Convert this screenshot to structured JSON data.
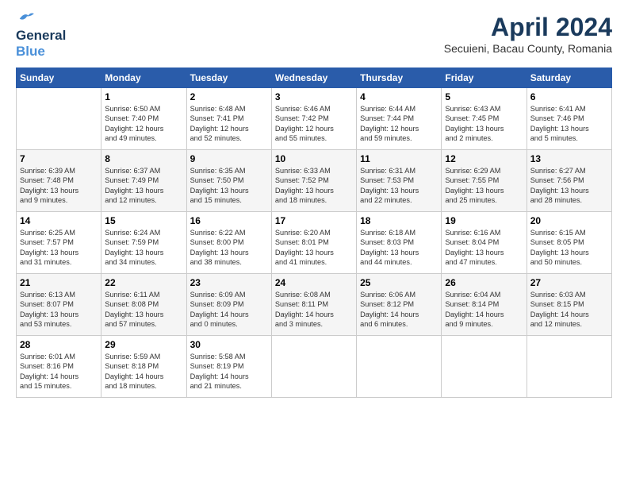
{
  "logo": {
    "line1": "General",
    "line2": "Blue"
  },
  "title": "April 2024",
  "subtitle": "Secuieni, Bacau County, Romania",
  "header_days": [
    "Sunday",
    "Monday",
    "Tuesday",
    "Wednesday",
    "Thursday",
    "Friday",
    "Saturday"
  ],
  "weeks": [
    [
      {
        "num": "",
        "info": ""
      },
      {
        "num": "1",
        "info": "Sunrise: 6:50 AM\nSunset: 7:40 PM\nDaylight: 12 hours\nand 49 minutes."
      },
      {
        "num": "2",
        "info": "Sunrise: 6:48 AM\nSunset: 7:41 PM\nDaylight: 12 hours\nand 52 minutes."
      },
      {
        "num": "3",
        "info": "Sunrise: 6:46 AM\nSunset: 7:42 PM\nDaylight: 12 hours\nand 55 minutes."
      },
      {
        "num": "4",
        "info": "Sunrise: 6:44 AM\nSunset: 7:44 PM\nDaylight: 12 hours\nand 59 minutes."
      },
      {
        "num": "5",
        "info": "Sunrise: 6:43 AM\nSunset: 7:45 PM\nDaylight: 13 hours\nand 2 minutes."
      },
      {
        "num": "6",
        "info": "Sunrise: 6:41 AM\nSunset: 7:46 PM\nDaylight: 13 hours\nand 5 minutes."
      }
    ],
    [
      {
        "num": "7",
        "info": "Sunrise: 6:39 AM\nSunset: 7:48 PM\nDaylight: 13 hours\nand 9 minutes."
      },
      {
        "num": "8",
        "info": "Sunrise: 6:37 AM\nSunset: 7:49 PM\nDaylight: 13 hours\nand 12 minutes."
      },
      {
        "num": "9",
        "info": "Sunrise: 6:35 AM\nSunset: 7:50 PM\nDaylight: 13 hours\nand 15 minutes."
      },
      {
        "num": "10",
        "info": "Sunrise: 6:33 AM\nSunset: 7:52 PM\nDaylight: 13 hours\nand 18 minutes."
      },
      {
        "num": "11",
        "info": "Sunrise: 6:31 AM\nSunset: 7:53 PM\nDaylight: 13 hours\nand 22 minutes."
      },
      {
        "num": "12",
        "info": "Sunrise: 6:29 AM\nSunset: 7:55 PM\nDaylight: 13 hours\nand 25 minutes."
      },
      {
        "num": "13",
        "info": "Sunrise: 6:27 AM\nSunset: 7:56 PM\nDaylight: 13 hours\nand 28 minutes."
      }
    ],
    [
      {
        "num": "14",
        "info": "Sunrise: 6:25 AM\nSunset: 7:57 PM\nDaylight: 13 hours\nand 31 minutes."
      },
      {
        "num": "15",
        "info": "Sunrise: 6:24 AM\nSunset: 7:59 PM\nDaylight: 13 hours\nand 34 minutes."
      },
      {
        "num": "16",
        "info": "Sunrise: 6:22 AM\nSunset: 8:00 PM\nDaylight: 13 hours\nand 38 minutes."
      },
      {
        "num": "17",
        "info": "Sunrise: 6:20 AM\nSunset: 8:01 PM\nDaylight: 13 hours\nand 41 minutes."
      },
      {
        "num": "18",
        "info": "Sunrise: 6:18 AM\nSunset: 8:03 PM\nDaylight: 13 hours\nand 44 minutes."
      },
      {
        "num": "19",
        "info": "Sunrise: 6:16 AM\nSunset: 8:04 PM\nDaylight: 13 hours\nand 47 minutes."
      },
      {
        "num": "20",
        "info": "Sunrise: 6:15 AM\nSunset: 8:05 PM\nDaylight: 13 hours\nand 50 minutes."
      }
    ],
    [
      {
        "num": "21",
        "info": "Sunrise: 6:13 AM\nSunset: 8:07 PM\nDaylight: 13 hours\nand 53 minutes."
      },
      {
        "num": "22",
        "info": "Sunrise: 6:11 AM\nSunset: 8:08 PM\nDaylight: 13 hours\nand 57 minutes."
      },
      {
        "num": "23",
        "info": "Sunrise: 6:09 AM\nSunset: 8:09 PM\nDaylight: 14 hours\nand 0 minutes."
      },
      {
        "num": "24",
        "info": "Sunrise: 6:08 AM\nSunset: 8:11 PM\nDaylight: 14 hours\nand 3 minutes."
      },
      {
        "num": "25",
        "info": "Sunrise: 6:06 AM\nSunset: 8:12 PM\nDaylight: 14 hours\nand 6 minutes."
      },
      {
        "num": "26",
        "info": "Sunrise: 6:04 AM\nSunset: 8:14 PM\nDaylight: 14 hours\nand 9 minutes."
      },
      {
        "num": "27",
        "info": "Sunrise: 6:03 AM\nSunset: 8:15 PM\nDaylight: 14 hours\nand 12 minutes."
      }
    ],
    [
      {
        "num": "28",
        "info": "Sunrise: 6:01 AM\nSunset: 8:16 PM\nDaylight: 14 hours\nand 15 minutes."
      },
      {
        "num": "29",
        "info": "Sunrise: 5:59 AM\nSunset: 8:18 PM\nDaylight: 14 hours\nand 18 minutes."
      },
      {
        "num": "30",
        "info": "Sunrise: 5:58 AM\nSunset: 8:19 PM\nDaylight: 14 hours\nand 21 minutes."
      },
      {
        "num": "",
        "info": ""
      },
      {
        "num": "",
        "info": ""
      },
      {
        "num": "",
        "info": ""
      },
      {
        "num": "",
        "info": ""
      }
    ]
  ]
}
